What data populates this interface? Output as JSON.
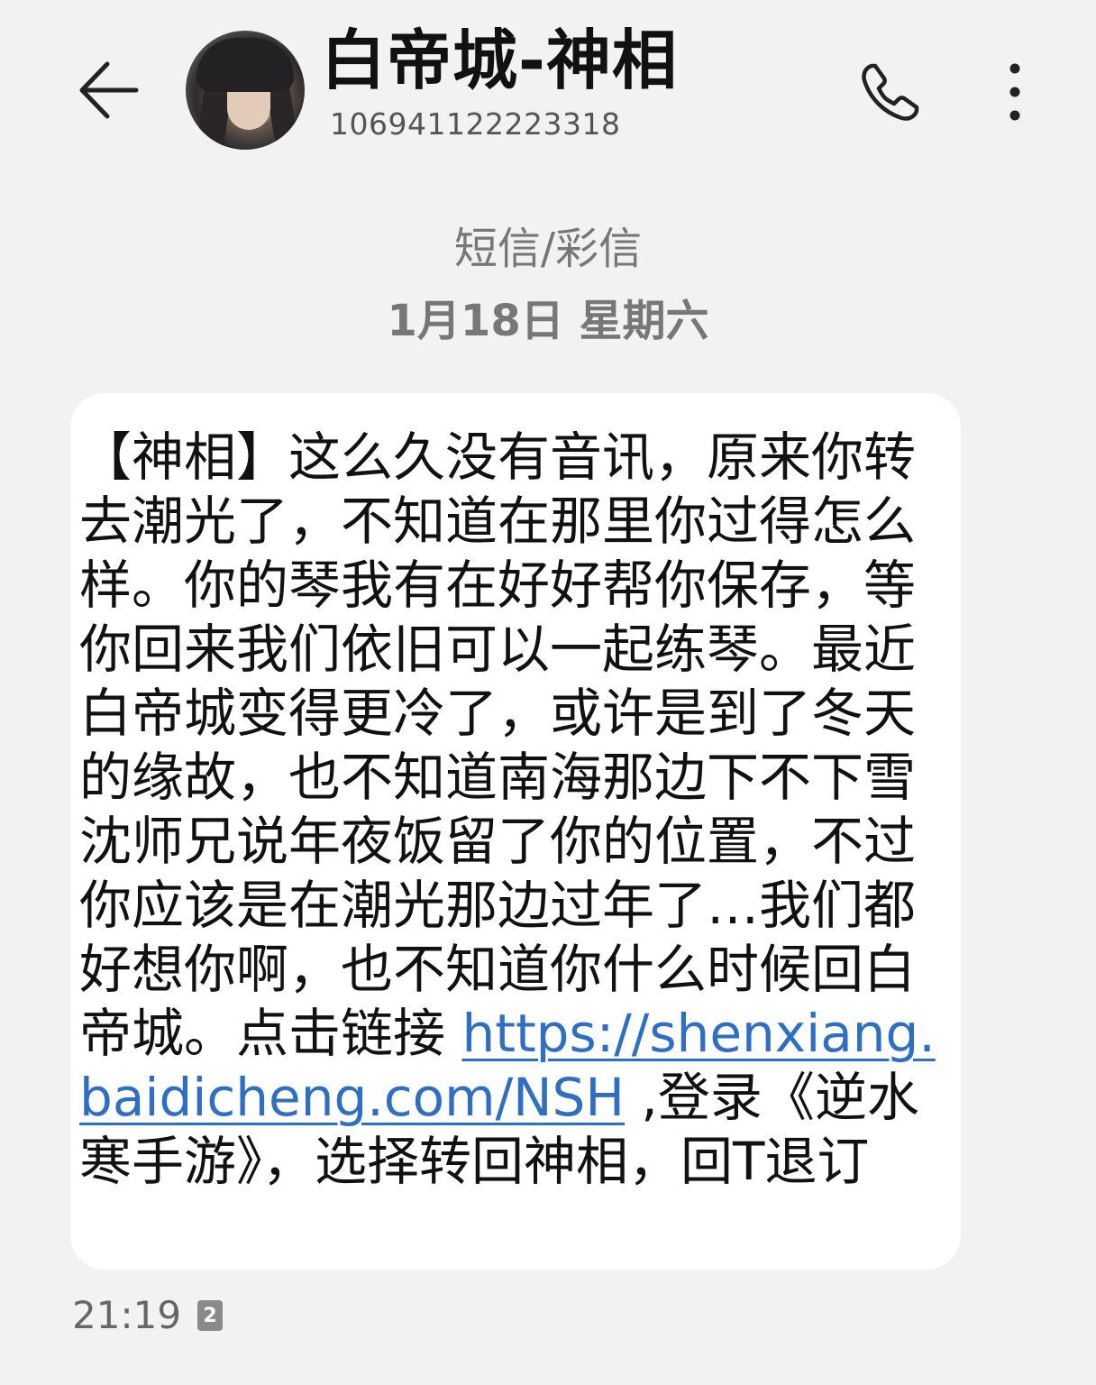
{
  "header": {
    "back_icon": "arrow-left-icon",
    "contact_name": "白帝城-神相",
    "contact_number": "106941122223318",
    "call_icon": "phone-icon",
    "more_icon": "more-vertical-icon"
  },
  "conversation": {
    "channel_label": "短信/彩信",
    "date_label": "1月18日 星期六"
  },
  "message": {
    "lines": [
      "【神相】这么久没有音讯，原来你转",
      "去潮光了，不知道在那里你过得怎么",
      "样。你的琴我有在好好帮你保存，等",
      "你回来我们依旧可以一起练琴。最近",
      "白帝城变得更冷了，或许是到了冬天",
      "的缘故，也不知道南海那边下不下雪",
      "沈师兄说年夜饭留了你的位置，不过",
      "你应该是在潮光那边过年了…我们都",
      "好想你啊，也不知道你什么时候回白"
    ],
    "line10_text": "帝城。点击链接 ",
    "link_part1": "https://shenxiang.",
    "link_part2": "baidicheng.com/NSH",
    "line11_text": " ,登录《逆水",
    "line12_text": "寒手游》，选择转回神相，回T退订",
    "link_color": "#2f6fc2"
  },
  "meta": {
    "time": "21:19",
    "sim_badge": "2"
  }
}
